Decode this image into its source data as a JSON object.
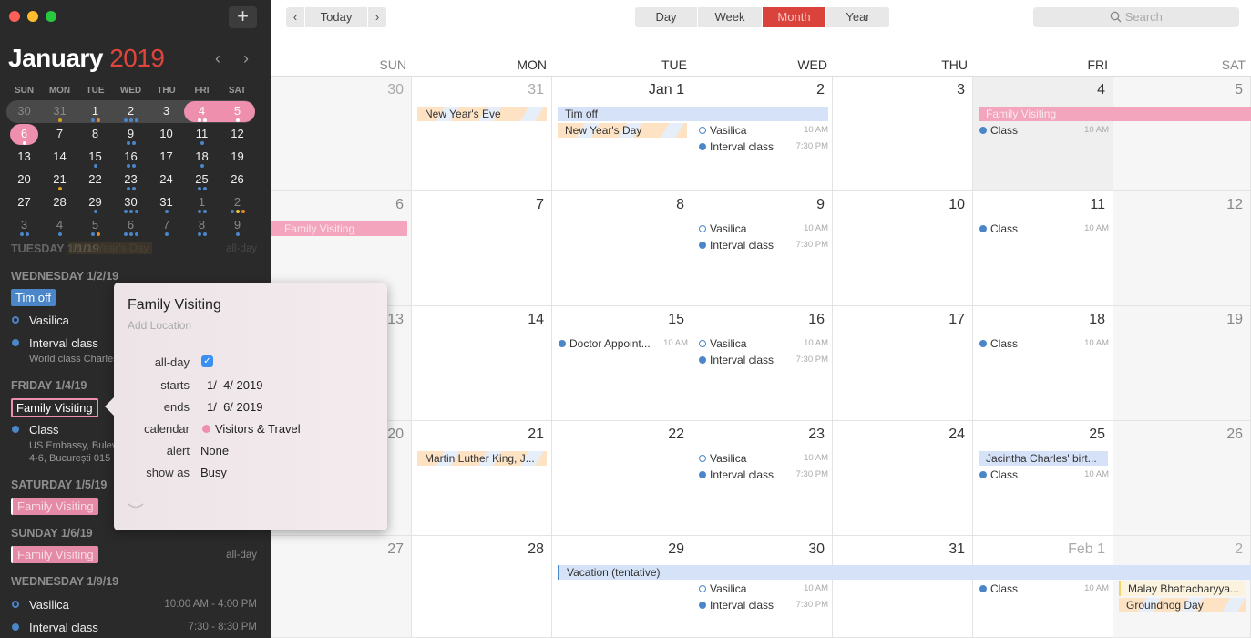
{
  "window": {
    "traffic_lights": [
      "#fe5f57",
      "#febc2e",
      "#28c840"
    ]
  },
  "sidebar": {
    "add_button": "+",
    "month": "January",
    "year": "2019",
    "prev": "‹",
    "next": "›",
    "dow": [
      "SUN",
      "MON",
      "TUE",
      "WED",
      "THU",
      "FRI",
      "SAT"
    ],
    "weeks": [
      [
        {
          "d": "30",
          "dim": true,
          "dots": []
        },
        {
          "d": "31",
          "dim": true,
          "dots": [
            "#d9a11f"
          ]
        },
        {
          "d": "1",
          "dots": [
            "#4a86c8",
            "#e0892d"
          ]
        },
        {
          "d": "2",
          "dots": [
            "#4a86c8",
            "#4a86c8",
            "#4a86c8"
          ]
        },
        {
          "d": "3",
          "dots": []
        },
        {
          "d": "4",
          "dots": [
            "#fff",
            "#fff"
          ]
        },
        {
          "d": "5",
          "dots": [
            "#fff"
          ]
        }
      ],
      [
        {
          "d": "6",
          "dots": [
            "#fff"
          ]
        },
        {
          "d": "7",
          "dots": []
        },
        {
          "d": "8",
          "dots": []
        },
        {
          "d": "9",
          "dots": [
            "#4a86c8",
            "#4a86c8"
          ]
        },
        {
          "d": "10",
          "dots": []
        },
        {
          "d": "11",
          "dots": [
            "#4a86c8"
          ]
        },
        {
          "d": "12",
          "dots": []
        }
      ],
      [
        {
          "d": "13",
          "dots": []
        },
        {
          "d": "14",
          "dots": []
        },
        {
          "d": "15",
          "dots": [
            "#4a86c8"
          ]
        },
        {
          "d": "16",
          "dots": [
            "#4a86c8",
            "#4a86c8"
          ]
        },
        {
          "d": "17",
          "dots": []
        },
        {
          "d": "18",
          "dots": [
            "#4a86c8"
          ]
        },
        {
          "d": "19",
          "dots": []
        }
      ],
      [
        {
          "d": "20",
          "dots": []
        },
        {
          "d": "21",
          "dots": [
            "#d9a11f"
          ]
        },
        {
          "d": "22",
          "dots": []
        },
        {
          "d": "23",
          "dots": [
            "#4a86c8",
            "#4a86c8"
          ]
        },
        {
          "d": "24",
          "dots": []
        },
        {
          "d": "25",
          "dots": [
            "#4a86c8",
            "#4a86c8"
          ]
        },
        {
          "d": "26",
          "dots": []
        }
      ],
      [
        {
          "d": "27",
          "dots": []
        },
        {
          "d": "28",
          "dots": []
        },
        {
          "d": "29",
          "dots": [
            "#4a86c8"
          ]
        },
        {
          "d": "30",
          "dots": [
            "#4a86c8",
            "#4a86c8",
            "#4a86c8"
          ]
        },
        {
          "d": "31",
          "dots": [
            "#4a86c8"
          ]
        },
        {
          "d": "1",
          "dim": true,
          "dots": [
            "#4a86c8",
            "#4a86c8"
          ]
        },
        {
          "d": "2",
          "dim": true,
          "dots": [
            "#4a86c8",
            "#e8c53a",
            "#e0892d"
          ]
        }
      ],
      [
        {
          "d": "3",
          "dim": true,
          "dots": [
            "#4a86c8",
            "#4a86c8"
          ]
        },
        {
          "d": "4",
          "dim": true,
          "dots": [
            "#4a86c8"
          ]
        },
        {
          "d": "5",
          "dim": true,
          "dots": [
            "#4a86c8",
            "#e0892d"
          ]
        },
        {
          "d": "6",
          "dim": true,
          "dots": [
            "#4a86c8",
            "#4a86c8",
            "#4a86c8"
          ]
        },
        {
          "d": "7",
          "dim": true,
          "dots": [
            "#4a86c8"
          ]
        },
        {
          "d": "8",
          "dim": true,
          "dots": [
            "#4a86c8",
            "#4a86c8"
          ]
        },
        {
          "d": "9",
          "dim": true,
          "dots": [
            "#4a86c8"
          ]
        }
      ]
    ],
    "agenda": {
      "tue_head": "TUESDAY 1/1/19",
      "tue_event": "New Year's Day",
      "tue_time": "all-day",
      "wed_head": "WEDNESDAY 1/2/19",
      "wed_badge": "Tim off",
      "wed_ev1": "Vasilica",
      "wed_ev2": "Interval class",
      "wed_ev2_sub": "World class Charles",
      "fri_head": "FRIDAY 1/4/19",
      "fri_badge": "Family Visiting",
      "fri_ev1": "Class",
      "fri_ev1_sub1": "US Embassy, Bulevardul",
      "fri_ev1_sub2": "4-6, București 015",
      "sat_head": "SATURDAY 1/5/19",
      "sat_badge": "Family Visiting",
      "sun_head": "SUNDAY 1/6/19",
      "sun_badge": "Family Visiting",
      "sun_time": "all-day",
      "wed9_head": "WEDNESDAY 1/9/19",
      "wed9_ev1": "Vasilica",
      "wed9_ev1_time": "10:00 AM - 4:00 PM",
      "wed9_ev2": "Interval class",
      "wed9_ev2_time": "7:30 - 8:30 PM"
    }
  },
  "toolbar": {
    "prev": "‹",
    "today": "Today",
    "next": "›",
    "views": [
      "Day",
      "Week",
      "Month",
      "Year"
    ],
    "active_view": "Month",
    "search_placeholder": "Search",
    "search_icon": "magnifier-icon"
  },
  "calendar": {
    "dow": [
      "SUN",
      "MON",
      "TUE",
      "WED",
      "THU",
      "FRI",
      "SAT"
    ],
    "weeks": [
      [
        "30",
        "31",
        "Jan 1",
        "2",
        "3",
        "4",
        "5"
      ],
      [
        "6",
        "7",
        "8",
        "9",
        "10",
        "11",
        "12"
      ],
      [
        "13",
        "14",
        "15",
        "16",
        "17",
        "18",
        "19"
      ],
      [
        "20",
        "21",
        "22",
        "23",
        "24",
        "25",
        "26"
      ],
      [
        "27",
        "28",
        "29",
        "30",
        "31",
        "Feb 1",
        "2"
      ]
    ],
    "bars": [
      {
        "text": "New Year's Eve",
        "type": "hol"
      },
      {
        "text": "Tim off",
        "type": "blue"
      },
      {
        "text": "New Year's Day",
        "type": "hol"
      },
      {
        "text": "Family Visiting",
        "type": "pink"
      },
      {
        "text": "Family Visiting",
        "type": "pink"
      },
      {
        "text": "Martin Luther King, J...",
        "type": "hol"
      },
      {
        "text": "Jacintha Charles' birt...",
        "type": "blue"
      },
      {
        "text": "Vacation (tentative)",
        "type": "blue"
      },
      {
        "text": "Malay Bhattacharyya...",
        "type": "yellow"
      },
      {
        "text": "Groundhog Day",
        "type": "hol"
      }
    ],
    "events": {
      "vasilica": "Vasilica",
      "interval": "Interval class",
      "class": "Class",
      "doctor": "Doctor Appoint...",
      "t10": "10 AM",
      "t730": "7:30 PM"
    }
  },
  "popover": {
    "title": "Family Visiting",
    "location_placeholder": "Add Location",
    "fields": {
      "allday_label": "all-day",
      "allday_checked": true,
      "starts_label": "starts",
      "starts": "1/  4/ 2019",
      "ends_label": "ends",
      "ends": "1/  6/ 2019",
      "calendar_label": "calendar",
      "calendar": "Visitors & Travel",
      "calendar_color": "#ee8fad",
      "alert_label": "alert",
      "alert": "None",
      "showas_label": "show as",
      "showas": "Busy"
    },
    "expand_icon": "chevron-down-icon"
  }
}
